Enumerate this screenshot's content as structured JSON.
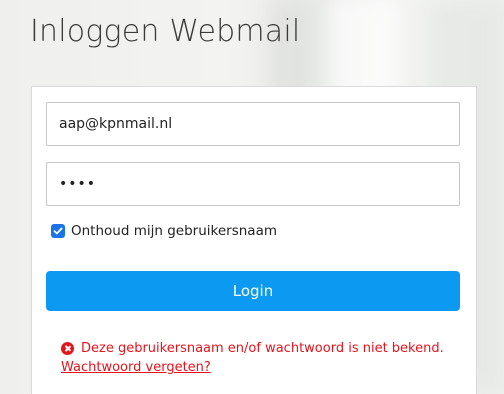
{
  "page": {
    "title": "Inloggen Webmail"
  },
  "login": {
    "email_value": "aap@kpnmail.nl",
    "password_value": "••••",
    "remember_label": "Onthoud mijn gebruikersnaam",
    "remember_checked": true,
    "button_label": "Login"
  },
  "error": {
    "message": "Deze gebruikersnaam en/of wachtwoord is niet bekend.",
    "forgot_link": "Wachtwoord vergeten?",
    "icon": "error-x-circle-icon"
  },
  "colors": {
    "accent": "#0c99f2",
    "error": "#e4141c",
    "checkbox": "#1a73e8"
  }
}
